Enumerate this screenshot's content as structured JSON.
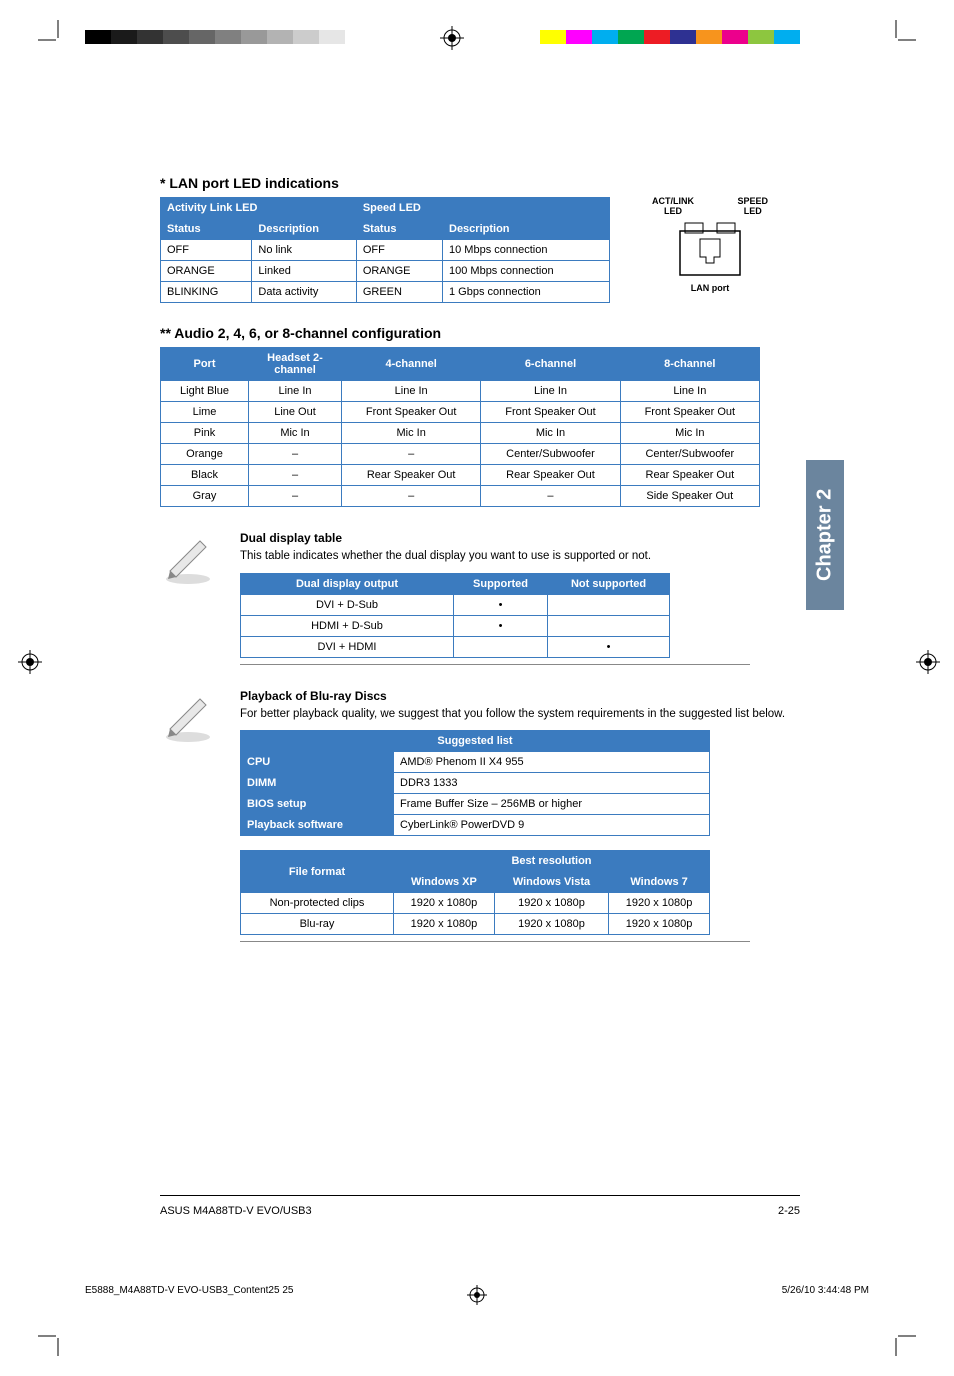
{
  "sections": {
    "lan_title": "* LAN port LED indications",
    "audio_title": "** Audio 2, 4, 6, or 8-channel configuration"
  },
  "lan_table": {
    "group_headers": [
      "Activity Link LED",
      "Speed LED"
    ],
    "sub_headers": [
      "Status",
      "Description",
      "Status",
      "Description"
    ],
    "rows": [
      [
        "OFF",
        "No link",
        "OFF",
        "10 Mbps connection"
      ],
      [
        "ORANGE",
        "Linked",
        "ORANGE",
        "100 Mbps connection"
      ],
      [
        "BLINKING",
        "Data activity",
        "GREEN",
        "1 Gbps connection"
      ]
    ]
  },
  "lan_diagram": {
    "left_label_1": "ACT/LINK",
    "left_label_2": "LED",
    "right_label_1": "SPEED",
    "right_label_2": "LED",
    "caption": "LAN port"
  },
  "audio_table": {
    "headers": [
      "Port",
      "Headset 2-channel",
      "4-channel",
      "6-channel",
      "8-channel"
    ],
    "rows": [
      [
        "Light Blue",
        "Line In",
        "Line In",
        "Line In",
        "Line In"
      ],
      [
        "Lime",
        "Line Out",
        "Front Speaker Out",
        "Front Speaker Out",
        "Front Speaker Out"
      ],
      [
        "Pink",
        "Mic In",
        "Mic In",
        "Mic In",
        "Mic In"
      ],
      [
        "Orange",
        "–",
        "–",
        "Center/Subwoofer",
        "Center/Subwoofer"
      ],
      [
        "Black",
        "–",
        "Rear Speaker Out",
        "Rear Speaker Out",
        "Rear Speaker Out"
      ],
      [
        "Gray",
        "–",
        "–",
        "–",
        "Side Speaker Out"
      ]
    ]
  },
  "dual_note": {
    "title": "Dual display table",
    "text": "This table indicates whether the dual display you want to use is supported or not.",
    "headers": [
      "Dual display output",
      "Supported",
      "Not supported"
    ],
    "rows": [
      [
        "DVI + D-Sub",
        "•",
        ""
      ],
      [
        "HDMI + D-Sub",
        "•",
        ""
      ],
      [
        "DVI + HDMI",
        "",
        "•"
      ]
    ]
  },
  "bluray_note": {
    "title": "Playback of Blu-ray Discs",
    "text": "For better playback quality, we suggest that you follow the system requirements in the suggested list below.",
    "suggest_header": "Suggested list",
    "suggest_rows": [
      [
        "CPU",
        "AMD® Phenom II X4 955"
      ],
      [
        "DIMM",
        "DDR3 1333"
      ],
      [
        "BIOS setup",
        "Frame Buffer Size – 256MB or higher"
      ],
      [
        "Playback software",
        "CyberLink® PowerDVD 9"
      ]
    ],
    "res_headers_top": [
      "File format",
      "Best resolution"
    ],
    "res_headers_sub": [
      "Windows XP",
      "Windows Vista",
      "Windows 7"
    ],
    "res_rows": [
      [
        "Non-protected clips",
        "1920 x 1080p",
        "1920 x 1080p",
        "1920 x 1080p"
      ],
      [
        "Blu-ray",
        "1920 x 1080p",
        "1920 x 1080p",
        "1920 x 1080p"
      ]
    ]
  },
  "chapter_tab": "Chapter 2",
  "footer": {
    "left": "ASUS M4A88TD-V EVO/USB3",
    "right": "2-25"
  },
  "printer_footer": {
    "left": "E5888_M4A88TD-V EVO-USB3_Content25   25",
    "right": "5/26/10   3:44:48 PM"
  }
}
